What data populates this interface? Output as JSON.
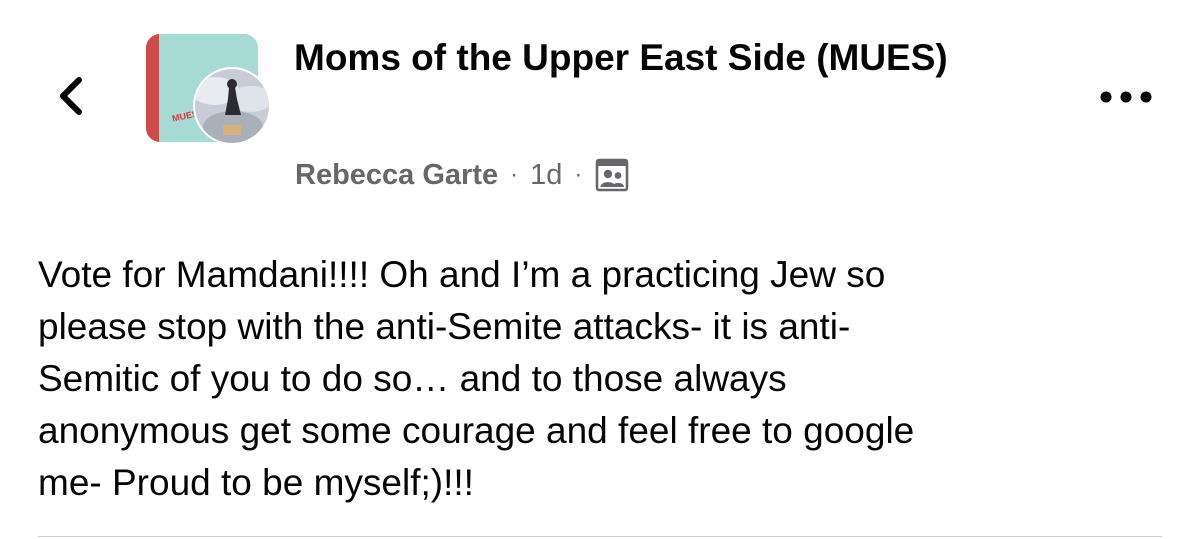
{
  "header": {
    "back_icon": "chevron-left-icon",
    "group_name": "Moms of the Upper East Side (MUES)",
    "group_avatar_text": "MUES",
    "more_icon": "ellipsis-icon"
  },
  "post": {
    "author": "Rebecca Garte",
    "separator": "·",
    "time": "1d",
    "privacy_icon": "group-members-icon",
    "body": "Vote for Mamdani!!!!  Oh and I’m a practicing Jew so\nplease stop with the anti-Semite attacks- it is anti-\nSemitic of you to do so… and to those always\nanonymous get some courage and feel free to google\nme- Proud to be myself;)!!!"
  },
  "colors": {
    "text": "#050505",
    "secondary_text": "#65676b",
    "group_avatar_bg": "#a6dad5",
    "group_avatar_strip": "#cf4a4a",
    "divider": "#c9ccd1"
  }
}
